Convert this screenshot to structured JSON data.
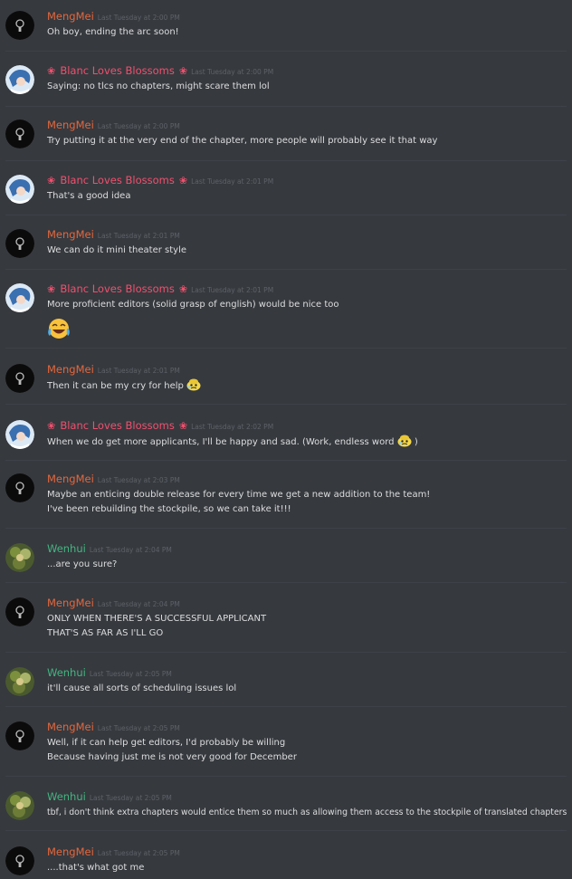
{
  "users": {
    "mengmei": {
      "name": "MengMei",
      "color": "#e4673d"
    },
    "blanc": {
      "name": "Blanc Loves Blossoms",
      "decoration": "❀",
      "color": "#f0506e"
    },
    "wenhui": {
      "name": "Wenhui",
      "color": "#43b581"
    }
  },
  "messages": [
    {
      "author": "MengMei",
      "timestamp": "Last Tuesday at 2:00 PM",
      "lines": [
        "Oh boy, ending the arc soon!"
      ]
    },
    {
      "author": "Blanc Loves Blossoms",
      "timestamp": "Last Tuesday at 2:00 PM",
      "lines": [
        "Saying: no tlcs no chapters, might scare them lol"
      ]
    },
    {
      "author": "MengMei",
      "timestamp": "Last Tuesday at 2:00 PM",
      "lines": [
        "Try putting it at the very end of the chapter, more people will probably see it that way"
      ]
    },
    {
      "author": "Blanc Loves Blossoms",
      "timestamp": "Last Tuesday at 2:01 PM",
      "lines": [
        "That's a good idea"
      ]
    },
    {
      "author": "MengMei",
      "timestamp": "Last Tuesday at 2:01 PM",
      "lines": [
        "We can do it mini theater style"
      ]
    },
    {
      "author": "Blanc Loves Blossoms",
      "timestamp": "Last Tuesday at 2:01 PM",
      "lines": [
        "More proficient editors (solid grasp of english) would be nice too"
      ],
      "emoji": "joy-emoji"
    },
    {
      "author": "MengMei",
      "timestamp": "Last Tuesday at 2:01 PM",
      "lines": [
        "Then it can be my cry for help"
      ],
      "inline_emoji": "custom-emoji"
    },
    {
      "author": "Blanc Loves Blossoms",
      "timestamp": "Last Tuesday at 2:02 PM",
      "lines": [
        "When we do get more applicants, I'll be happy and sad. (Work, endless word",
        ")"
      ],
      "inline_emoji": "custom-emoji"
    },
    {
      "author": "MengMei",
      "timestamp": "Last Tuesday at 2:03 PM",
      "lines": [
        "Maybe an enticing double release for every time we get a new addition to the team!",
        "I've been rebuilding the stockpile, so we can take it!!!"
      ]
    },
    {
      "author": "Wenhui",
      "timestamp": "Last Tuesday at 2:04 PM",
      "lines": [
        "...are you sure?"
      ]
    },
    {
      "author": "MengMei",
      "timestamp": "Last Tuesday at 2:04 PM",
      "lines": [
        "ONLY WHEN THERE'S A SUCCESSFUL APPLICANT",
        "THAT'S AS FAR AS I'LL GO"
      ]
    },
    {
      "author": "Wenhui",
      "timestamp": "Last Tuesday at 2:05 PM",
      "lines": [
        "it'll cause all sorts of scheduling issues lol"
      ]
    },
    {
      "author": "MengMei",
      "timestamp": "Last Tuesday at 2:05 PM",
      "lines": [
        "Well, if it can help get editors, I'd probably be willing",
        "Because having just me is not very good for December"
      ]
    },
    {
      "author": "Wenhui",
      "timestamp": "Last Tuesday at 2:05 PM",
      "lines": [
        "tbf, i don't think extra chapters would entice them so much as allowing them access to the stockpile of translated chapters"
      ]
    },
    {
      "author": "MengMei",
      "timestamp": "Last Tuesday at 2:05 PM",
      "lines": [
        "....that's what got me"
      ]
    }
  ]
}
